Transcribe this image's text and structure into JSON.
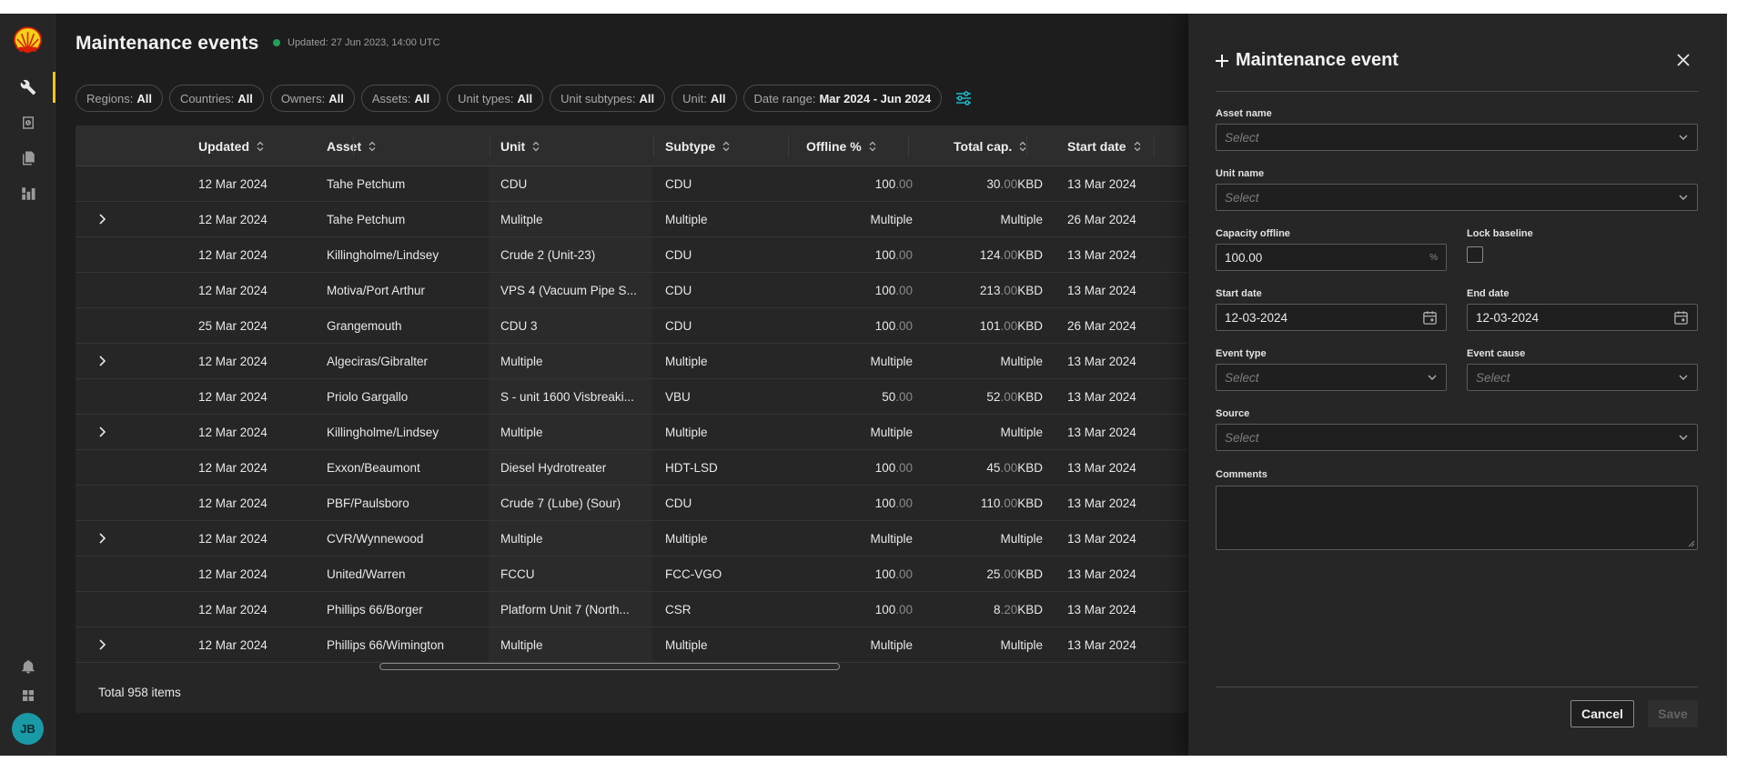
{
  "header": {
    "title": "Maintenance events",
    "updated": "Updated: 27 Jun 2023, 14:00 UTC"
  },
  "rail": {
    "items": [
      "wrench-icon",
      "clock-calendar-icon",
      "documents-icon",
      "dashboard-icon"
    ],
    "bottom_items": [
      "bell-icon",
      "apps-grid-icon"
    ],
    "avatar_initials": "JB",
    "accent": "#f5c518"
  },
  "filters": [
    {
      "label": "Regions:",
      "value": "All"
    },
    {
      "label": "Countries:",
      "value": "All"
    },
    {
      "label": "Owners:",
      "value": "All"
    },
    {
      "label": "Assets:",
      "value": "All"
    },
    {
      "label": "Unit types:",
      "value": "All"
    },
    {
      "label": "Unit subtypes:",
      "value": "All"
    },
    {
      "label": "Unit:",
      "value": "All"
    },
    {
      "label": "Date range:",
      "value": "Mar 2024 - Jun 2024"
    }
  ],
  "table": {
    "columns": [
      "Updated",
      "Asset",
      "Unit",
      "Subtype",
      "Offline %",
      "Total cap.",
      "Start date"
    ],
    "rows": [
      {
        "expand": false,
        "updated": "12 Mar 2024",
        "asset": "Tahe Petchum",
        "unit": "CDU",
        "subtype": "CDU",
        "offline_int": "100",
        "offline_dec": ".00",
        "offline_text": "",
        "cap_int": "30",
        "cap_dec": ".00",
        "cap_unit": " KBD",
        "cap_text": "",
        "start": "13 Mar 2024"
      },
      {
        "expand": true,
        "updated": "12 Mar 2024",
        "asset": "Tahe Petchum",
        "unit": "Mulitple",
        "subtype": "Multiple",
        "offline_int": "",
        "offline_dec": "",
        "offline_text": "Multiple",
        "cap_int": "",
        "cap_dec": "",
        "cap_unit": "",
        "cap_text": "Multiple",
        "start": "26 Mar 2024"
      },
      {
        "expand": false,
        "updated": "12 Mar 2024",
        "asset": "Killingholme/Lindsey",
        "unit": "Crude 2 (Unit-23)",
        "subtype": "CDU",
        "offline_int": "100",
        "offline_dec": ".00",
        "offline_text": "",
        "cap_int": "124",
        "cap_dec": ".00",
        "cap_unit": " KBD",
        "cap_text": "",
        "start": "13 Mar 2024"
      },
      {
        "expand": false,
        "updated": "12 Mar 2024",
        "asset": "Motiva/Port Arthur",
        "unit": "VPS 4 (Vacuum Pipe S...",
        "subtype": "CDU",
        "offline_int": "100",
        "offline_dec": ".00",
        "offline_text": "",
        "cap_int": "213",
        "cap_dec": ".00",
        "cap_unit": " KBD",
        "cap_text": "",
        "start": "13 Mar 2024"
      },
      {
        "expand": false,
        "updated": "25 Mar 2024",
        "asset": "Grangemouth",
        "unit": "CDU 3",
        "subtype": "CDU",
        "offline_int": "100",
        "offline_dec": ".00",
        "offline_text": "",
        "cap_int": "101",
        "cap_dec": ".00",
        "cap_unit": " KBD",
        "cap_text": "",
        "start": "26 Mar 2024"
      },
      {
        "expand": true,
        "updated": "12 Mar 2024",
        "asset": "Algeciras/Gibralter",
        "unit": "Multiple",
        "subtype": "Multiple",
        "offline_int": "",
        "offline_dec": "",
        "offline_text": "Multiple",
        "cap_int": "",
        "cap_dec": "",
        "cap_unit": "",
        "cap_text": "Multiple",
        "start": "13 Mar 2024"
      },
      {
        "expand": false,
        "updated": "12 Mar 2024",
        "asset": "Priolo Gargallo",
        "unit": "S - unit 1600 Visbreaki...",
        "subtype": "VBU",
        "offline_int": "50",
        "offline_dec": ".00",
        "offline_text": "",
        "cap_int": "52",
        "cap_dec": ".00",
        "cap_unit": " KBD",
        "cap_text": "",
        "start": "13 Mar 2024"
      },
      {
        "expand": true,
        "updated": "12 Mar 2024",
        "asset": "Killingholme/Lindsey",
        "unit": "Multiple",
        "subtype": "Multiple",
        "offline_int": "",
        "offline_dec": "",
        "offline_text": "Multiple",
        "cap_int": "",
        "cap_dec": "",
        "cap_unit": "",
        "cap_text": "Multiple",
        "start": "13 Mar 2024"
      },
      {
        "expand": false,
        "updated": "12 Mar 2024",
        "asset": "Exxon/Beaumont",
        "unit": "Diesel Hydrotreater",
        "subtype": "HDT-LSD",
        "offline_int": "100",
        "offline_dec": ".00",
        "offline_text": "",
        "cap_int": "45",
        "cap_dec": ".00",
        "cap_unit": " KBD",
        "cap_text": "",
        "start": "13 Mar 2024"
      },
      {
        "expand": false,
        "updated": "12 Mar 2024",
        "asset": "PBF/Paulsboro",
        "unit": "Crude 7 (Lube) (Sour)",
        "subtype": "CDU",
        "offline_int": "100",
        "offline_dec": ".00",
        "offline_text": "",
        "cap_int": "110",
        "cap_dec": ".00",
        "cap_unit": " KBD",
        "cap_text": "",
        "start": "13 Mar 2024"
      },
      {
        "expand": true,
        "updated": "12 Mar 2024",
        "asset": "CVR/Wynnewood",
        "unit": "Multiple",
        "subtype": "Multiple",
        "offline_int": "",
        "offline_dec": "",
        "offline_text": "Multiple",
        "cap_int": "",
        "cap_dec": "",
        "cap_unit": "",
        "cap_text": "Multiple",
        "start": "13 Mar 2024"
      },
      {
        "expand": false,
        "updated": "12 Mar 2024",
        "asset": "United/Warren",
        "unit": "FCCU",
        "subtype": "FCC-VGO",
        "offline_int": "100",
        "offline_dec": ".00",
        "offline_text": "",
        "cap_int": "25",
        "cap_dec": ".00",
        "cap_unit": " KBD",
        "cap_text": "",
        "start": "13 Mar 2024"
      },
      {
        "expand": false,
        "updated": "12 Mar 2024",
        "asset": "Phillips 66/Borger",
        "unit": "Platform Unit 7 (North...",
        "subtype": "CSR",
        "offline_int": "100",
        "offline_dec": ".00",
        "offline_text": "",
        "cap_int": "8",
        "cap_dec": ".20",
        "cap_unit": " KBD",
        "cap_text": "",
        "start": "13 Mar 2024"
      },
      {
        "expand": true,
        "updated": "12 Mar 2024",
        "asset": "Phillips 66/Wimington",
        "unit": "Multiple",
        "subtype": "Multiple",
        "offline_int": "",
        "offline_dec": "",
        "offline_text": "Multiple",
        "cap_int": "",
        "cap_dec": "",
        "cap_unit": "",
        "cap_text": "Multiple",
        "start": "13 Mar 2024"
      }
    ],
    "total": "Total 958 items"
  },
  "drawer": {
    "title": "Maintenance event",
    "asset_name": {
      "label": "Asset name",
      "placeholder": "Select"
    },
    "unit_name": {
      "label": "Unit name",
      "placeholder": "Select"
    },
    "capacity_offline": {
      "label": "Capacity offline",
      "value": "100.00",
      "suffix": "%"
    },
    "lock_baseline": {
      "label": "Lock baseline",
      "checked": false
    },
    "start_date": {
      "label": "Start date",
      "value": "12-03-2024"
    },
    "end_date": {
      "label": "End date",
      "value": "12-03-2024"
    },
    "event_type": {
      "label": "Event type",
      "placeholder": "Select"
    },
    "event_cause": {
      "label": "Event cause",
      "placeholder": "Select"
    },
    "source": {
      "label": "Source",
      "placeholder": "Select"
    },
    "comments": {
      "label": "Comments",
      "value": ""
    },
    "cancel_label": "Cancel",
    "save_label": "Save"
  },
  "colors": {
    "background": "#1d1d1d",
    "panel": "#262626",
    "status_green": "#21a058",
    "filter_icon": "#1fb6c8",
    "avatar": "#1a9aa6"
  }
}
